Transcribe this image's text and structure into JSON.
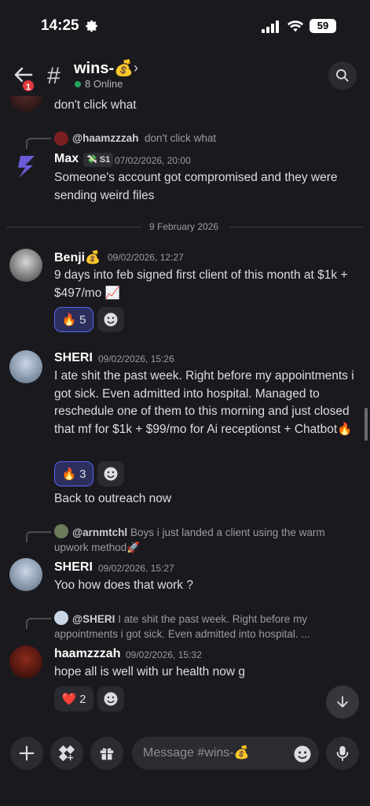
{
  "status_bar": {
    "time": "14:25",
    "battery": "59"
  },
  "header": {
    "back_badge": "1",
    "channel_name": "wins-💰",
    "online_count": "8 Online"
  },
  "divider": {
    "date": "9 February 2026"
  },
  "messages": {
    "top_partial": {
      "text": "don't click what"
    },
    "max": {
      "reply_user": "@haamzzzah",
      "reply_text": "don't click what",
      "username": "Max",
      "role_tag": "S1",
      "timestamp": "07/02/2026, 20:00",
      "text": "Someone's account got compromised and they were sending weird files"
    },
    "benji": {
      "username": "Benji💰",
      "timestamp": "09/02/2026, 12:27",
      "text": "9 days into feb signed first client of this month at $1k + $497/mo 📈",
      "reaction_emoji": "🔥",
      "reaction_count": "5"
    },
    "sheri1": {
      "username": "SHERI",
      "timestamp": "09/02/2026, 15:26",
      "text": "I ate shit the past week. Right before my appointments i got sick. Even admitted into hospital. Managed to reschedule one of them to this morning and just closed that mf for $1k + $99/mo for Ai receptionst + Chatbot🔥",
      "reaction_emoji": "🔥",
      "reaction_count": "3",
      "followup": "Back to outreach now"
    },
    "sheri2": {
      "reply_user": "@arnmtchl",
      "reply_text": "Boys i just landed a client using the warm upwork method🚀",
      "username": "SHERI",
      "timestamp": "09/02/2026, 15:27",
      "text": "Yoo how does that work ?"
    },
    "haamzzzah": {
      "reply_user": "@SHERI",
      "reply_text": "I ate shit the past week. Right before my appointments i got sick. Even admitted into hospital. ...",
      "username": "haamzzzah",
      "timestamp": "09/02/2026, 15:32",
      "text": "hope all is well with ur health now g",
      "reaction_emoji": "❤️",
      "reaction_count": "2"
    }
  },
  "composer": {
    "placeholder": "Message #wins-💰"
  },
  "colors": {
    "background": "#1a1a1e",
    "accent": "#5865f2",
    "online": "#23a55a",
    "badge": "#e03a3e"
  }
}
